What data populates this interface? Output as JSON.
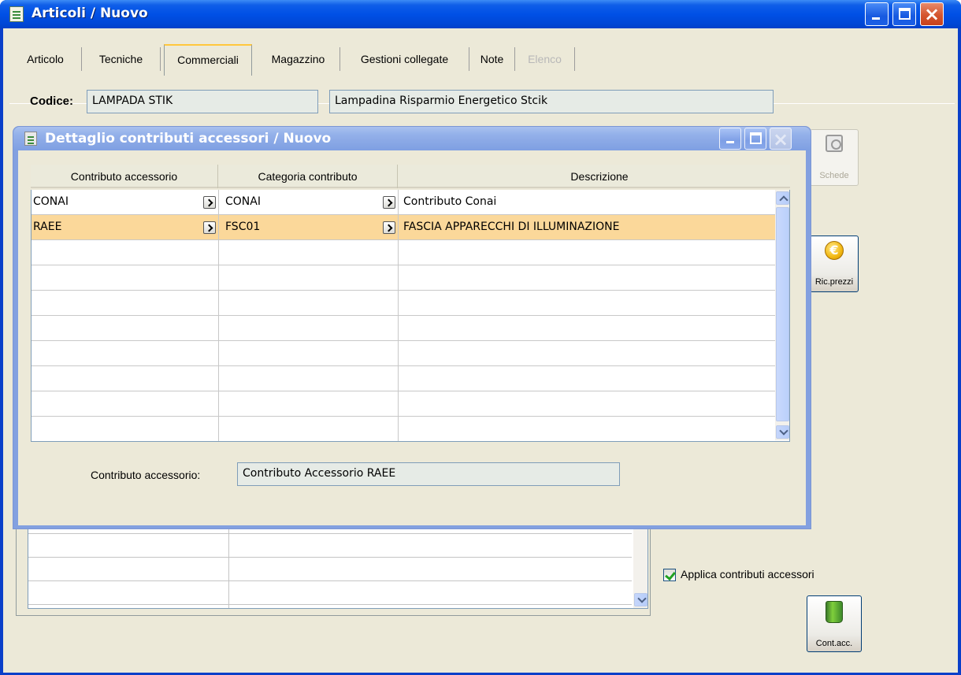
{
  "window": {
    "title": "Articoli / Nuovo"
  },
  "tabs": [
    {
      "label": "Articolo"
    },
    {
      "label": "Tecniche"
    },
    {
      "label": "Commerciali"
    },
    {
      "label": "Magazzino"
    },
    {
      "label": "Gestioni collegate"
    },
    {
      "label": "Note"
    },
    {
      "label": "Elenco"
    }
  ],
  "codice": {
    "label": "Codice:",
    "value": "LAMPADA STIK",
    "description": "Lampadina Risparmio Energetico Stcik"
  },
  "buttons": {
    "schede": "Schede",
    "ric_prezzi": "Ric.prezzi",
    "cont_acc": "Cont.acc.",
    "coin_glyph": "€"
  },
  "checkbox": {
    "label": "Applica contributi accessori",
    "checked": true
  },
  "dialog": {
    "title": "Dettaglio contributi accessori / Nuovo",
    "columns": [
      "Contributo accessorio",
      "Categoria contributo",
      "Descrizione"
    ],
    "rows": [
      {
        "contributo": "CONAI",
        "categoria": "CONAI",
        "descrizione": "Contributo Conai"
      },
      {
        "contributo": "RAEE",
        "categoria": "FSC01",
        "descrizione": "FASCIA APPARECCHI DI ILLUMINAZIONE"
      }
    ],
    "detail_label": "Contributo accessorio:",
    "detail_value": "Contributo Accessorio RAEE"
  },
  "colors": {
    "titlebar_active": "#0050e6",
    "titlebar_inactive": "#8ba9e6",
    "client_bg": "#ece9d8",
    "selected_row": "#fbd89a",
    "field_bg": "#e6ebe6"
  }
}
